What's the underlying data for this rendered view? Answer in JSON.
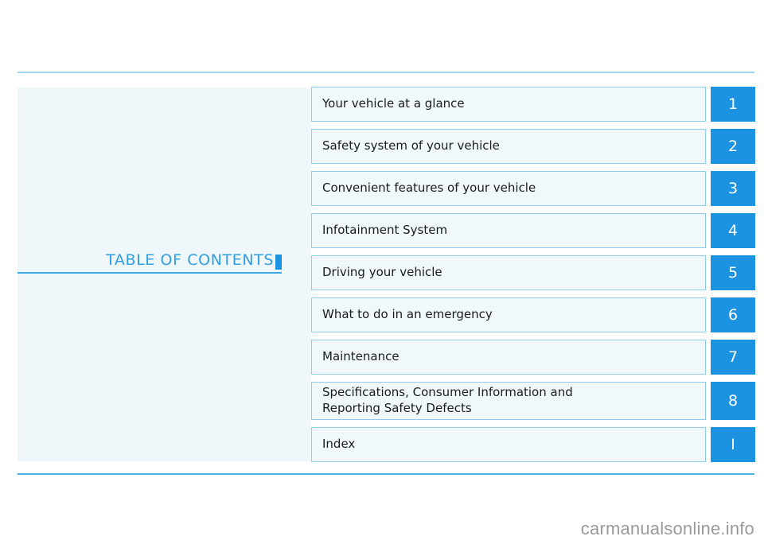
{
  "document": {
    "heading": "TABLE OF CONTENTS",
    "watermark": "carmanualsonline.info"
  },
  "colors": {
    "accent_blue": "#1b93e0",
    "heading_blue": "#2e9fe4",
    "box_border": "#8ecdf0",
    "box_fill": "#f0f8fc",
    "panel_fill": "#eff7fb",
    "rule_top": "#9ed5ef",
    "rule_bottom": "#4fb0e8",
    "watermark_gray": "#9a9a9a"
  },
  "contents": [
    {
      "label": "Your vehicle at a glance",
      "badge": "1"
    },
    {
      "label": "Safety system of your vehicle",
      "badge": "2"
    },
    {
      "label": "Convenient features of your vehicle",
      "badge": "3"
    },
    {
      "label": "Infotainment System",
      "badge": "4"
    },
    {
      "label": "Driving your vehicle",
      "badge": "5"
    },
    {
      "label": "What to do in an emergency",
      "badge": "6"
    },
    {
      "label": "Maintenance",
      "badge": "7"
    },
    {
      "label": "Specifications, Consumer Information and\nReporting Safety Defects",
      "badge": "8"
    },
    {
      "label": "Index",
      "badge": "I"
    }
  ]
}
